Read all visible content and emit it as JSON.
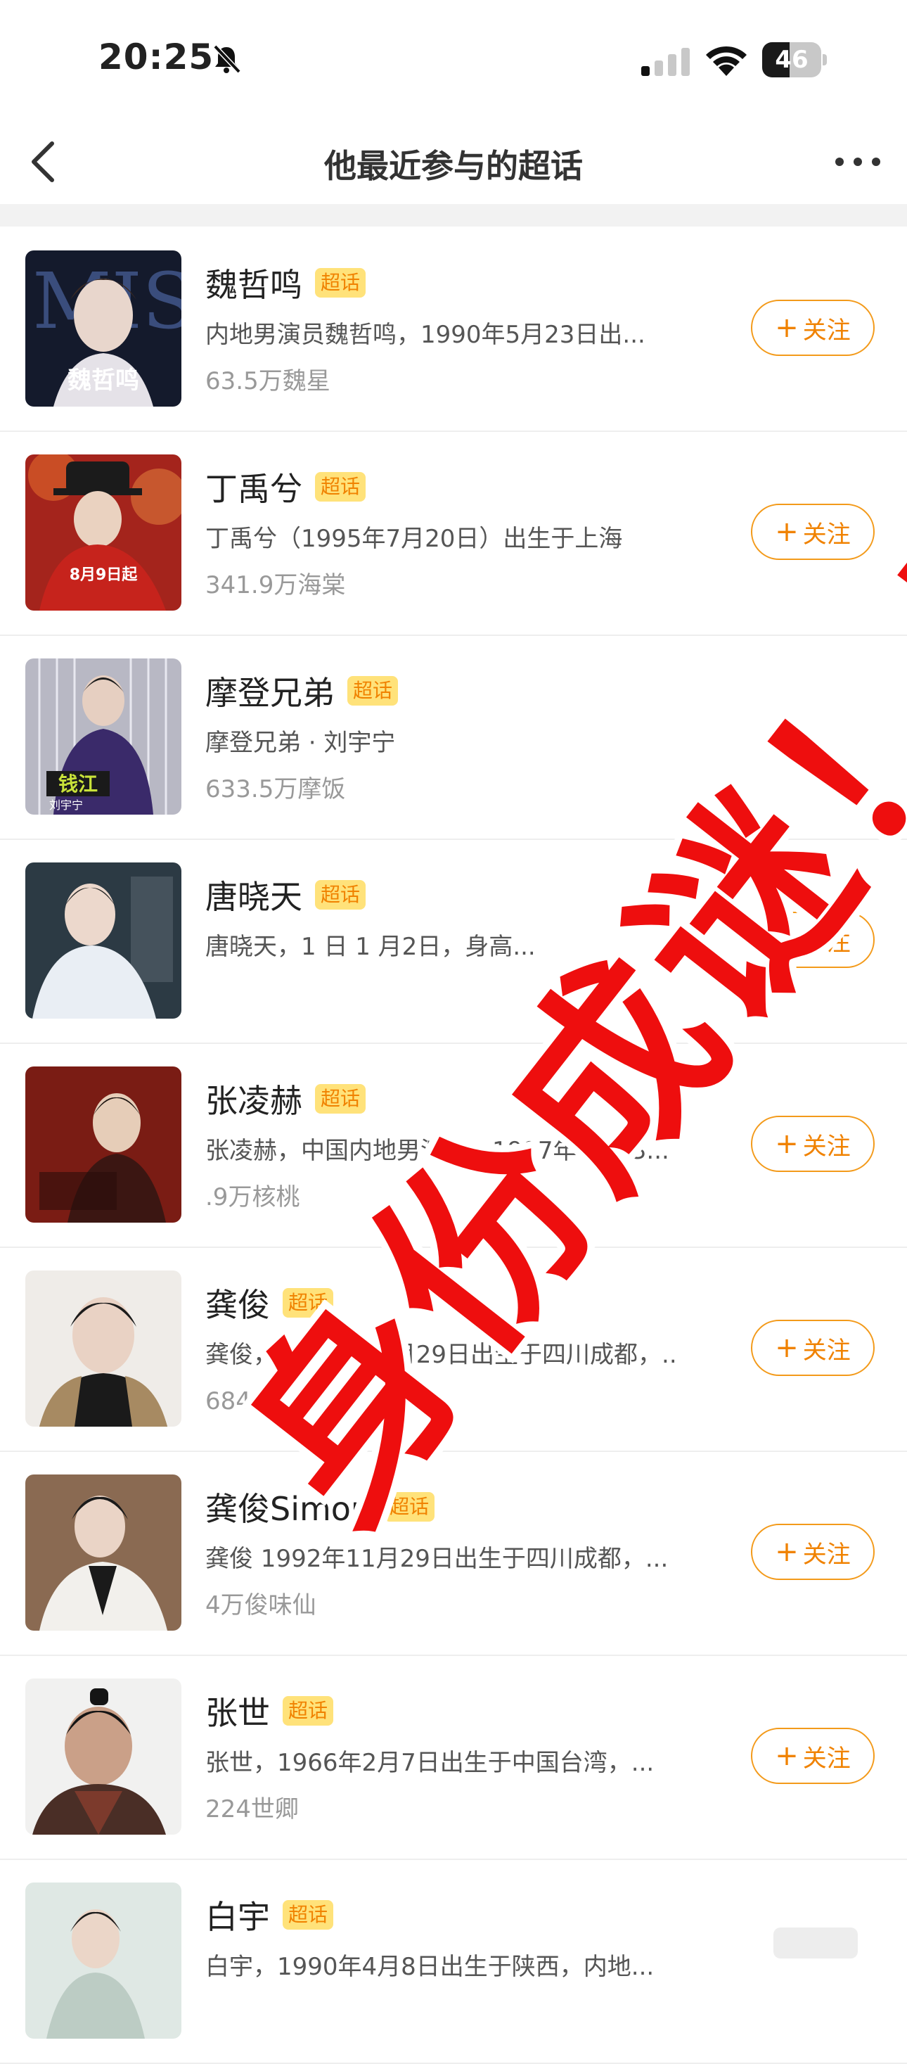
{
  "status_bar": {
    "time": "20:25",
    "battery": "46",
    "battery_level": 0.46
  },
  "nav": {
    "title": "他最近参与的超话"
  },
  "badge_label": "超话",
  "follow_label": "关注",
  "follow_plus": "+",
  "items": [
    {
      "name": "魏哲鸣",
      "desc": "内地男演员魏哲鸣，1990年5月23日出...",
      "fans": "63.5万魏星"
    },
    {
      "name": "丁禹兮",
      "desc": "丁禹兮（1995年7月20日）出生于上海",
      "fans": "341.9万海棠"
    },
    {
      "name": "摩登兄弟",
      "desc": "摩登兄弟 · 刘宇宁",
      "fans": "633.5万摩饭"
    },
    {
      "name": "唐晓天",
      "desc": "唐晓天，1  日  1  月2日，身高...",
      "fans": ""
    },
    {
      "name": "张凌赫",
      "desc": "张凌赫，中国内地男演员，1997年12月3...",
      "fans": "  .9万核桃"
    },
    {
      "name": "龚俊",
      "desc": "龚俊，1992年11月29日出生于四川成都，..",
      "fans": "684.9万俊味仙"
    },
    {
      "name": "龚俊Simon",
      "desc": "龚俊 1992年11月29日出生于四川成都，...",
      "fans": "4万俊味仙"
    },
    {
      "name": "张世",
      "desc": "张世，1966年2月7日出生于中国台湾，...",
      "fans": "224世卿"
    },
    {
      "name": "白宇",
      "desc": "白宇，1990年4月8日出生于陕西，内地...",
      "fans": ""
    }
  ],
  "thumb_text": {
    "t0": "魏哲鸣",
    "t1": "8月9日起",
    "t2": "刘宇宁"
  },
  "overlay": {
    "text": "身份成谜！！",
    "color": "#ee0e0e"
  },
  "colors": {
    "accent": "#f08200",
    "badge_bg": "#ffe27a"
  }
}
